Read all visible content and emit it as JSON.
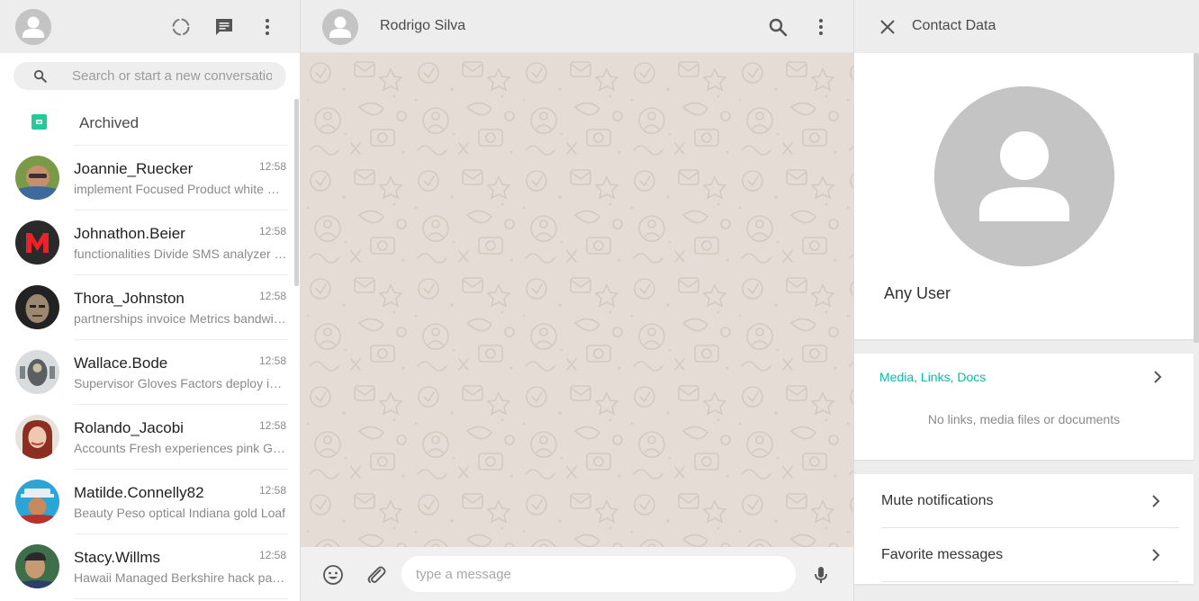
{
  "sidebar": {
    "header": {
      "avatar_icon": "person-avatar-icon",
      "status_icon": "status-circle-icon",
      "new_chat_icon": "chat-bubble-icon",
      "menu_icon": "vertical-dots-icon"
    },
    "search": {
      "placeholder": "Search or start a new conversation",
      "icon": "search-icon"
    },
    "archived": {
      "label": "Archived",
      "icon": "archive-box-icon",
      "icon_color": "#22c99b"
    },
    "chats": [
      {
        "name": "Joannie_Ruecker",
        "time": "12:58",
        "preview": "implement Focused Product white Kansas",
        "avatar_color": "#6b8f3a"
      },
      {
        "name": "Johnathon.Beier",
        "time": "12:58",
        "preview": "functionalities Divide SMS analyzer Wooden",
        "avatar_color": "#2a2a2a"
      },
      {
        "name": "Thora_Johnston",
        "time": "12:58",
        "preview": "partnerships invoice Metrics bandwidth",
        "avatar_color": "#3a3a3a"
      },
      {
        "name": "Wallace.Bode",
        "time": "12:58",
        "preview": "Supervisor Gloves Factors deploy invoice",
        "avatar_color": "#8f9a9e"
      },
      {
        "name": "Rolando_Jacobi",
        "time": "12:58",
        "preview": "Accounts Fresh experiences pink Granite",
        "avatar_color": "#b94a48"
      },
      {
        "name": "Matilde.Connelly82",
        "time": "12:58",
        "preview": "Beauty Peso optical Indiana gold Loaf",
        "avatar_color": "#2a8fb8"
      },
      {
        "name": "Stacy.Willms",
        "time": "12:58",
        "preview": "Hawaii Managed Berkshire hack payment",
        "avatar_color": "#2e5e3e"
      }
    ]
  },
  "chat": {
    "contact_name": "Rodrigo Silva",
    "search_icon": "search-icon",
    "menu_icon": "vertical-dots-icon",
    "composer": {
      "placeholder": "type a message",
      "emoji_icon": "emoji-icon",
      "attach_icon": "paperclip-icon",
      "mic_icon": "microphone-icon"
    },
    "background_color": "#e5ddd5"
  },
  "contact_panel": {
    "title": "Contact Data",
    "close_icon": "close-icon",
    "username": "Any User",
    "media": {
      "title": "Media, Links, Docs",
      "empty_text": "No links, media files or documents",
      "accent": "#00bfa5"
    },
    "options": [
      {
        "label": "Mute notifications"
      },
      {
        "label": "Favorite messages"
      }
    ]
  }
}
